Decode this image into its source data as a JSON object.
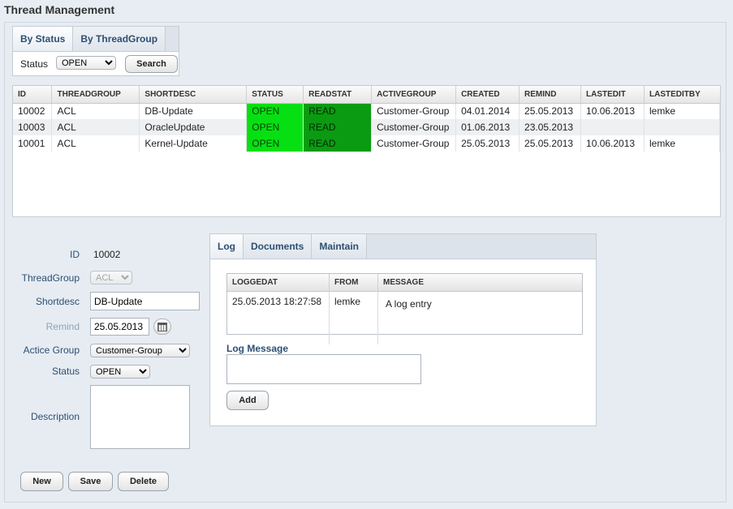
{
  "title": "Thread Management",
  "tabs": [
    "By Status",
    "By ThreadGroup"
  ],
  "filter": {
    "status_label": "Status",
    "status_value": "OPEN",
    "search_label": "Search"
  },
  "grid": {
    "columns": [
      "ID",
      "THREADGROUP",
      "SHORTDESC",
      "STATUS",
      "READSTAT",
      "ACTIVEGROUP",
      "CREATED",
      "REMIND",
      "LASTEDIT",
      "LASTEDITBY"
    ],
    "rows": [
      [
        "10002",
        "ACL",
        "DB-Update",
        "OPEN",
        "READ",
        "Customer-Group",
        "04.01.2014",
        "25.05.2013",
        "10.06.2013",
        "lemke"
      ],
      [
        "10003",
        "ACL",
        "OracleUpdate",
        "OPEN",
        "READ",
        "Customer-Group",
        "01.06.2013",
        "23.05.2013",
        "",
        ""
      ],
      [
        "10001",
        "ACL",
        "Kernel-Update",
        "OPEN",
        "READ",
        "Customer-Group",
        "25.05.2013",
        "25.05.2013",
        "10.06.2013",
        "lemke"
      ]
    ]
  },
  "form": {
    "id_label": "ID",
    "id_value": "10002",
    "threadgroup_label": "ThreadGroup",
    "threadgroup_value": "ACL",
    "shortdesc_label": "Shortdesc",
    "shortdesc_value": "DB-Update",
    "remind_label": "Remind",
    "remind_value": "25.05.2013",
    "activegroup_label": "Actice Group",
    "activegroup_value": "Customer-Group",
    "status_label": "Status",
    "status_value": "OPEN",
    "description_label": "Description"
  },
  "buttons": {
    "new": "New",
    "save": "Save",
    "delete": "Delete"
  },
  "log": {
    "tabs": [
      "Log",
      "Documents",
      "Maintain"
    ],
    "columns": [
      "LOGGEDAT",
      "FROM",
      "MESSAGE"
    ],
    "rows": [
      [
        "25.05.2013 18:27:58",
        "lemke",
        "A log entry"
      ]
    ],
    "message_label": "Log Message",
    "add_label": "Add"
  },
  "colors": {
    "status_open": "#06e012",
    "read": "#0a9b12",
    "accent": "#2d4f72"
  }
}
